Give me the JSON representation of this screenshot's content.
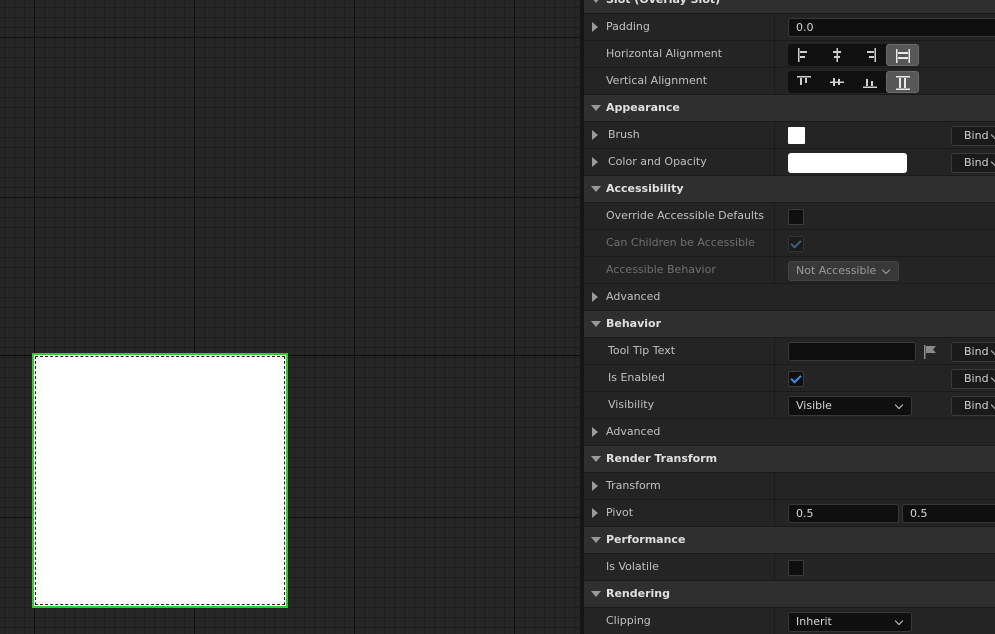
{
  "sections": {
    "slot": "Slot (Overlay Slot)",
    "appearance": "Appearance",
    "accessibility": "Accessibility",
    "behavior": "Behavior",
    "render_transform": "Render Transform",
    "performance": "Performance",
    "rendering": "Rendering"
  },
  "slot": {
    "padding_label": "Padding",
    "padding_value": "0.0",
    "halign_label": "Horizontal Alignment",
    "halign_selected": "fill",
    "valign_label": "Vertical Alignment",
    "valign_selected": "fill"
  },
  "appearance": {
    "brush_label": "Brush",
    "brush_color": "#ffffff",
    "color_label": "Color and Opacity",
    "color_value": "#ffffff"
  },
  "accessibility": {
    "override_label": "Override Accessible Defaults",
    "override_checked": false,
    "children_label": "Can Children be Accessible",
    "children_checked": true,
    "behavior_label": "Accessible Behavior",
    "behavior_value": "Not Accessible",
    "advanced_label": "Advanced"
  },
  "behavior": {
    "tooltip_label": "Tool Tip Text",
    "tooltip_value": "",
    "enabled_label": "Is Enabled",
    "enabled_checked": true,
    "visibility_label": "Visibility",
    "visibility_value": "Visible",
    "advanced_label": "Advanced"
  },
  "render_transform": {
    "transform_label": "Transform",
    "pivot_label": "Pivot",
    "pivot_x": "0.5",
    "pivot_y": "0.5"
  },
  "performance": {
    "volatile_label": "Is Volatile",
    "volatile_checked": false
  },
  "rendering": {
    "clipping_label": "Clipping",
    "clipping_value": "Inherit"
  },
  "bind_label": "Bind",
  "colors": {
    "selection_outline": "#2ad12a",
    "checkbox_accent": "#3a8ee6",
    "widget_fill": "#ffffff"
  }
}
